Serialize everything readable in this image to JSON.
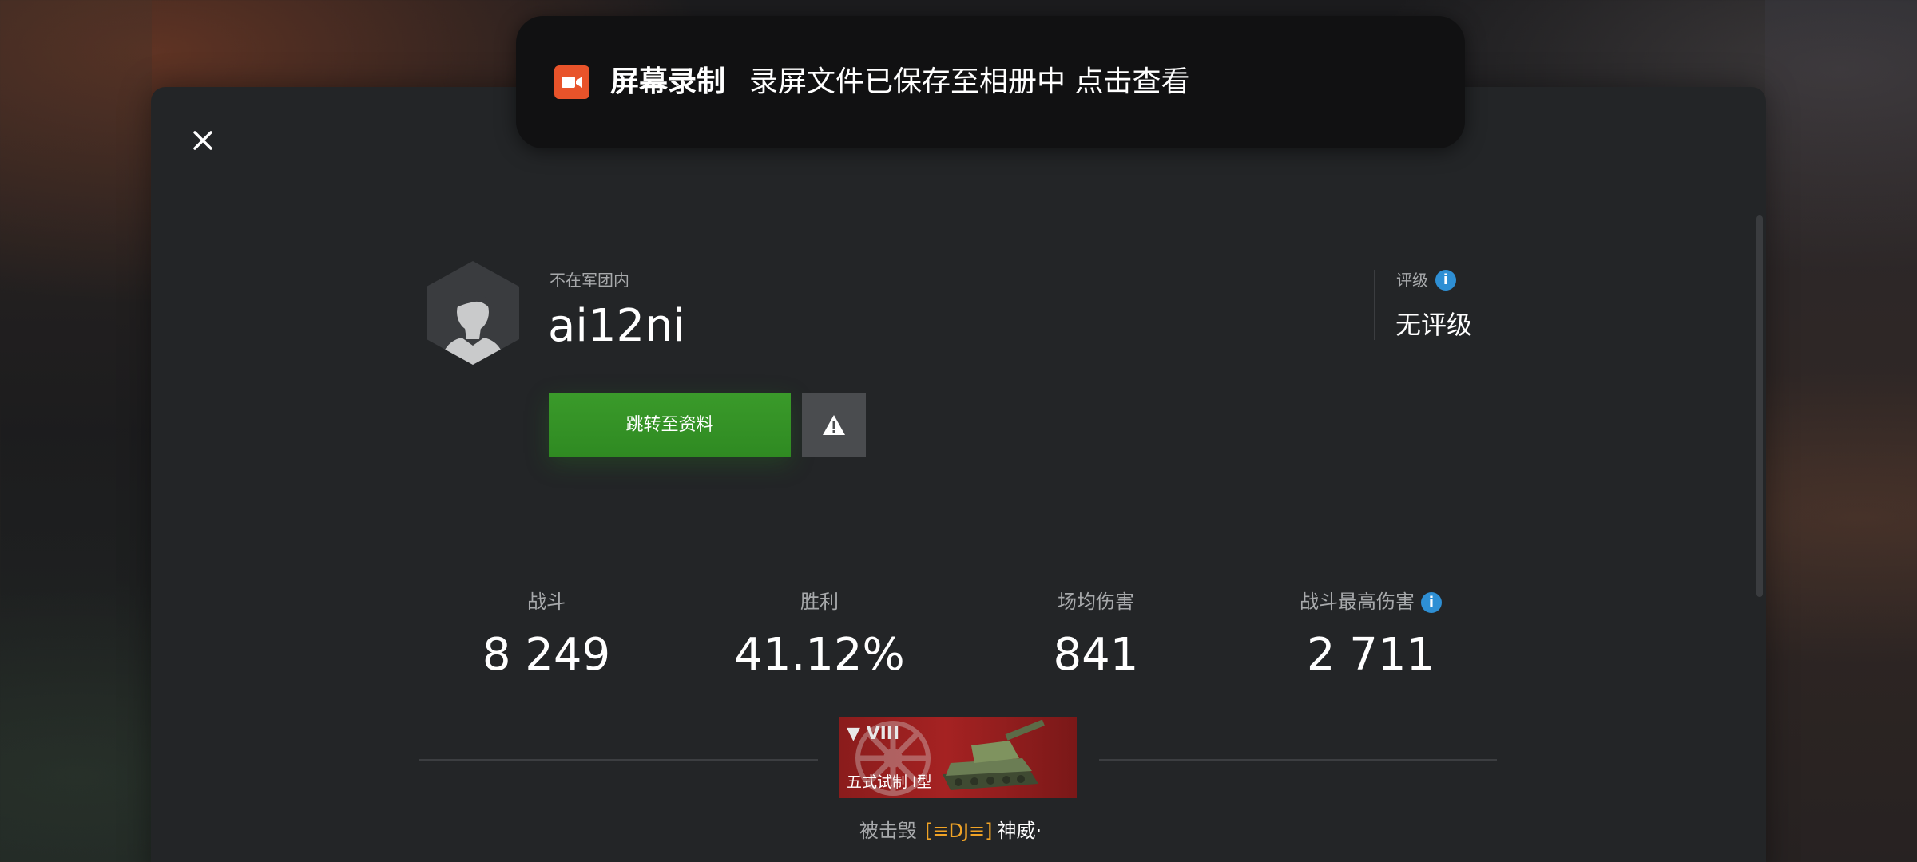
{
  "toast": {
    "app_name": "屏幕录制",
    "message": "录屏文件已保存至相册中 点击查看",
    "icon": "video-camera-icon",
    "icon_color": "#e8532a"
  },
  "profile": {
    "clan_status": "不在军团内",
    "username": "ai12ni",
    "rating_label": "评级",
    "rating_value": "无评级",
    "goto_profile_label": "跳转至资料"
  },
  "stats": [
    {
      "label": "战斗",
      "value": "8 249"
    },
    {
      "label": "胜利",
      "value": "41.12%"
    },
    {
      "label": "场均伤害",
      "value": "841"
    },
    {
      "label": "战斗最高伤害",
      "value": "2 711"
    }
  ],
  "tank": {
    "tier": "▼ VIII",
    "name": "五式试制 I型"
  },
  "destroyed": {
    "label": "被击毁",
    "clan_tag": "[≡DJ≡]",
    "player": "神威·"
  },
  "colors": {
    "accent_green": "#35932a",
    "info_blue": "#2e8fd4",
    "clan_tag_orange": "#f0a326",
    "panel": "#232527"
  }
}
